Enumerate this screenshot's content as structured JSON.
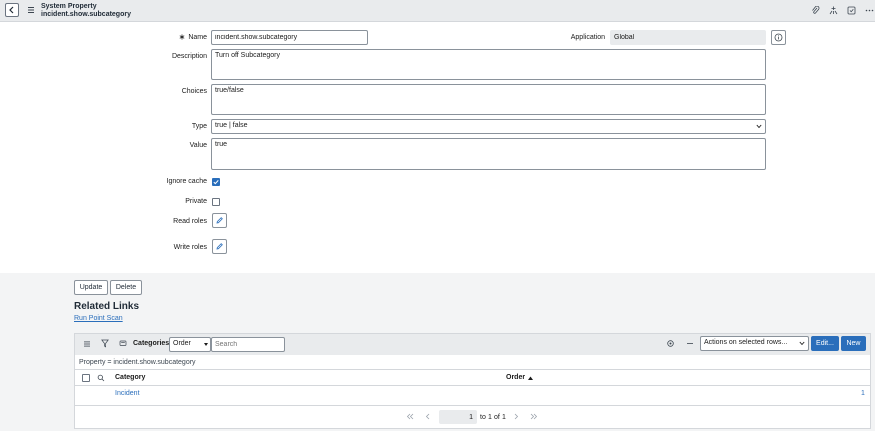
{
  "header": {
    "title_line1": "System Property",
    "title_line2": "incident.show.subcategory"
  },
  "form": {
    "name_label": "Name",
    "name_value": "incident.show.subcategory",
    "application_label": "Application",
    "application_value": "Global",
    "description_label": "Description",
    "description_value": "Turn off Subcategory",
    "choices_label": "Choices",
    "choices_value": "true/false",
    "type_label": "Type",
    "type_value": "true | false",
    "value_label": "Value",
    "value_value": "true",
    "ignore_cache_label": "Ignore cache",
    "ignore_cache_checked": true,
    "private_label": "Private",
    "private_checked": false,
    "read_roles_label": "Read roles",
    "write_roles_label": "Write roles"
  },
  "actions": {
    "update_label": "Update",
    "delete_label": "Delete"
  },
  "related": {
    "title": "Related Links",
    "link_label": "Run Point Scan"
  },
  "list": {
    "title": "Categories",
    "sort_selected": "Order",
    "search_placeholder": "Search",
    "actions_selected": "Actions on selected rows...",
    "edit_label": "Edit...",
    "new_label": "New",
    "breadcrumb": "Property = incident.show.subcategory",
    "columns": [
      "Category",
      "Order"
    ],
    "rows": [
      {
        "category": "Incident",
        "order": "1"
      }
    ],
    "pager": {
      "current": "1",
      "to_text": "to",
      "range_end": "1",
      "of_text": "of",
      "total": "1"
    }
  },
  "colors": {
    "accent": "#2a6ebb",
    "header_bg": "#e9ebed",
    "page_bg": "#f3f4f5"
  }
}
